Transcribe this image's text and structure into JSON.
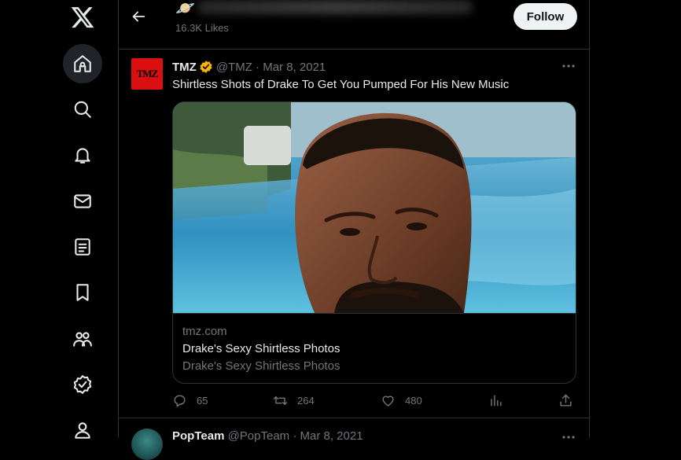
{
  "colors": {
    "background": "#000000",
    "follow_bg": "#eff3f4",
    "tmz_red": "#d90f10",
    "verified": "#f4b400"
  },
  "nav": {
    "items": [
      {
        "name": "x-logo-icon"
      },
      {
        "name": "home-icon"
      },
      {
        "name": "search-icon"
      },
      {
        "name": "notifications-icon"
      },
      {
        "name": "messages-icon"
      },
      {
        "name": "lists-icon"
      },
      {
        "name": "bookmarks-icon"
      },
      {
        "name": "communities-icon"
      },
      {
        "name": "verified-icon"
      },
      {
        "name": "profile-icon"
      }
    ]
  },
  "header": {
    "emoji": "🪐",
    "likes": "16.3K Likes",
    "follow_label": "Follow"
  },
  "tweet": {
    "avatar_text": "TMZ",
    "name": "TMZ",
    "handle_date": "@TMZ · Mar 8, 2021",
    "text": "Shirtless Shots of Drake To Get You Pumped For His New Music",
    "card": {
      "domain": "tmz.com",
      "title": "Drake's Sexy Shirtless Photos",
      "description": "Drake's Sexy Shirtless Photos"
    },
    "actions": {
      "replies": "65",
      "reposts": "264",
      "likes": "480"
    }
  },
  "next_tweet": {
    "name": "PopTeam",
    "handle_date": "@PopTeam · Mar 8, 2021"
  }
}
